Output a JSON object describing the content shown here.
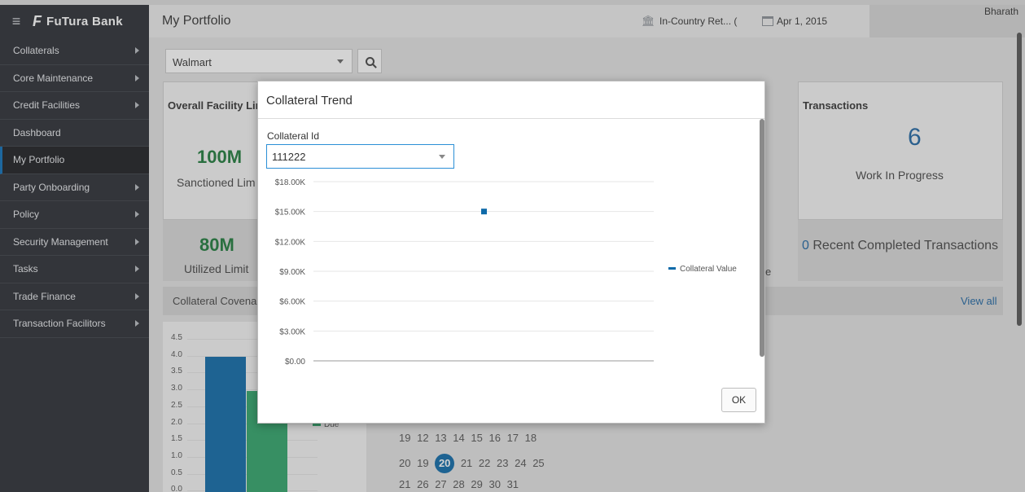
{
  "header": {
    "brand": "FuTura Bank",
    "page_title": "My Portfolio",
    "entity": "In-Country Ret... (",
    "date": "Apr 1, 2015",
    "user": "Bharath"
  },
  "sidebar": {
    "items": [
      {
        "label": "Collaterals",
        "has_arrow": true
      },
      {
        "label": "Core Maintenance",
        "has_arrow": true
      },
      {
        "label": "Credit Facilities",
        "has_arrow": true
      },
      {
        "label": "Dashboard",
        "has_arrow": false
      },
      {
        "label": "My Portfolio",
        "has_arrow": false,
        "active": true
      },
      {
        "label": "Party Onboarding",
        "has_arrow": true
      },
      {
        "label": "Policy",
        "has_arrow": true
      },
      {
        "label": "Security Management",
        "has_arrow": true
      },
      {
        "label": "Tasks",
        "has_arrow": true
      },
      {
        "label": "Trade Finance",
        "has_arrow": true
      },
      {
        "label": "Transaction Facilitors",
        "has_arrow": true
      }
    ]
  },
  "background": {
    "party_select": "Walmart",
    "facility_card_title": "Overall Facility Lir",
    "sanctioned_value": "100M",
    "sanctioned_label": "Sanctioned Lim",
    "utilized_value": "80M",
    "utilized_label": "Utilized Limit",
    "covenant_title": "Collateral Covena",
    "transactions_title": "Transactions",
    "transactions_count": "6",
    "work_in_progress_label": "Work In Progress",
    "recent_count": "0",
    "recent_label": "Recent Completed Transactions",
    "view_all": "View all",
    "partial_text": "e",
    "legend_due": "Due",
    "small_chart_ticks": [
      "4.5",
      "4.0",
      "3.5",
      "3.0",
      "2.5",
      "2.0",
      "1.5",
      "1.0",
      "0.5",
      "0.0"
    ],
    "calendar_rows": [
      [
        "19",
        "12",
        "13",
        "14",
        "15",
        "16",
        "17",
        "18"
      ],
      [
        "20",
        "19",
        "20",
        "21",
        "22",
        "23",
        "24",
        "25"
      ],
      [
        "21",
        "26",
        "27",
        "28",
        "29",
        "30",
        "31"
      ]
    ],
    "colors": {
      "bar_blue": "#0e6aa9",
      "bar_green": "#2fa56a"
    }
  },
  "modal": {
    "title": "Collateral Trend",
    "field_label": "Collateral Id",
    "collateral_id": "111222",
    "ok_label": "OK"
  },
  "chart_data": {
    "type": "scatter",
    "y_ticks": [
      "$18.00K",
      "$15.00K",
      "$12.00K",
      "$9.00K",
      "$6.00K",
      "$3.00K",
      "$0.00"
    ],
    "ylim": [
      0,
      18000
    ],
    "series": [
      {
        "name": "Collateral Value",
        "color": "#0e6aa9",
        "points": [
          {
            "y": 15000
          }
        ]
      }
    ],
    "legend_position": "right",
    "grid": true
  }
}
